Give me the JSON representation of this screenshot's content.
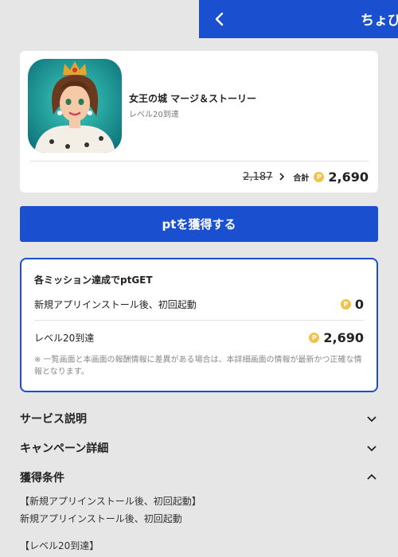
{
  "header": {
    "title": "ちょび",
    "back_icon": "chevron-left-icon",
    "color": "#1a4fd0"
  },
  "app": {
    "name": "女王の城 マージ＆ストーリー",
    "subtitle": "レベル20到達",
    "icon": "queen-portrait-app-icon",
    "old_price": "2,187",
    "total_label": "合計",
    "point_symbol": "P",
    "total_value": "2,690"
  },
  "cta": {
    "label": "ptを獲得する"
  },
  "mission": {
    "title": "各ミッション達成でptGET",
    "rows": [
      {
        "label": "新規アプリインストール後、初回起動",
        "value": "0"
      },
      {
        "label": "レベル20到達",
        "value": "2,690"
      }
    ],
    "note": "※ 一覧画面と本画面の報酬情報に差異がある場合は、本詳細画面の情報が最新かつ正確な情報となります。"
  },
  "sections": [
    {
      "label": "サービス説明",
      "state": "collapsed"
    },
    {
      "label": "キャンペーン詳細",
      "state": "collapsed"
    },
    {
      "label": "獲得条件",
      "state": "expanded"
    }
  ],
  "conditions": [
    "【新規アプリインストール後、初回起動】",
    "新規アプリインストール後、初回起動",
    "【レベル20到達】"
  ],
  "colors": {
    "accent": "#1a4fd0",
    "coin": "#f2c24a",
    "background": "#e6e6e6"
  }
}
